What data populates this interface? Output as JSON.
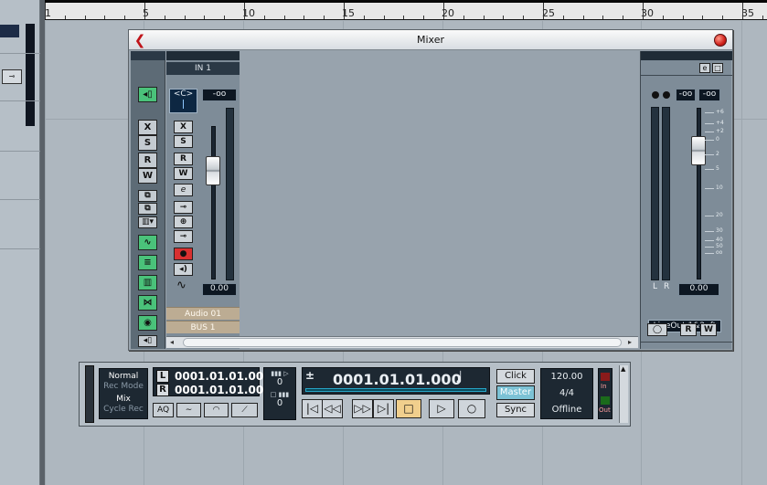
{
  "ruler": {
    "marks": [
      "1",
      "5",
      "10",
      "15",
      "20",
      "25",
      "30",
      "35"
    ]
  },
  "mixer": {
    "title": "Mixer",
    "input_channel": {
      "header": "IN 1",
      "pan": "<C>",
      "volume_db": "-oo",
      "fader_value": "0.00",
      "buttons": [
        "X",
        "S",
        "R",
        "W",
        "e"
      ],
      "name": "Audio 01",
      "bus": "BUS 1"
    },
    "common_panel": {
      "buttons": [
        "X",
        "S",
        "R",
        "W"
      ]
    },
    "output_channel": {
      "peak_left": "-oo",
      "peak_right": "-oo",
      "fader_value": "0.00",
      "meter_labels": [
        "L",
        "R"
      ],
      "db_scale": [
        "+6",
        "+4",
        "+2",
        "0",
        "2",
        "5",
        "10",
        "20",
        "30",
        "40",
        "50",
        "oo"
      ],
      "name": "LineOut 1&2..ft",
      "buttons": [
        "R",
        "W"
      ]
    }
  },
  "transport": {
    "modes": {
      "normal": "Normal",
      "rec_mode": "Rec Mode",
      "mix": "Mix",
      "cycle_rec": "Cycle Rec"
    },
    "left_locator": "0001.01.01.000",
    "right_locator": "0001.01.01.000",
    "left_label": "L",
    "right_label": "R",
    "aq_label": "AQ",
    "pre_roll": "0",
    "post_roll": "0",
    "plus_minus": "±",
    "position": "0001.01.01.000",
    "note_glyph": "♩",
    "click_label": "Click",
    "master_label": "Master",
    "sync_label": "Sync",
    "tempo": "120.00",
    "signature": "4/4",
    "status": "Offline",
    "in_label": "In",
    "out_label": "Out"
  }
}
